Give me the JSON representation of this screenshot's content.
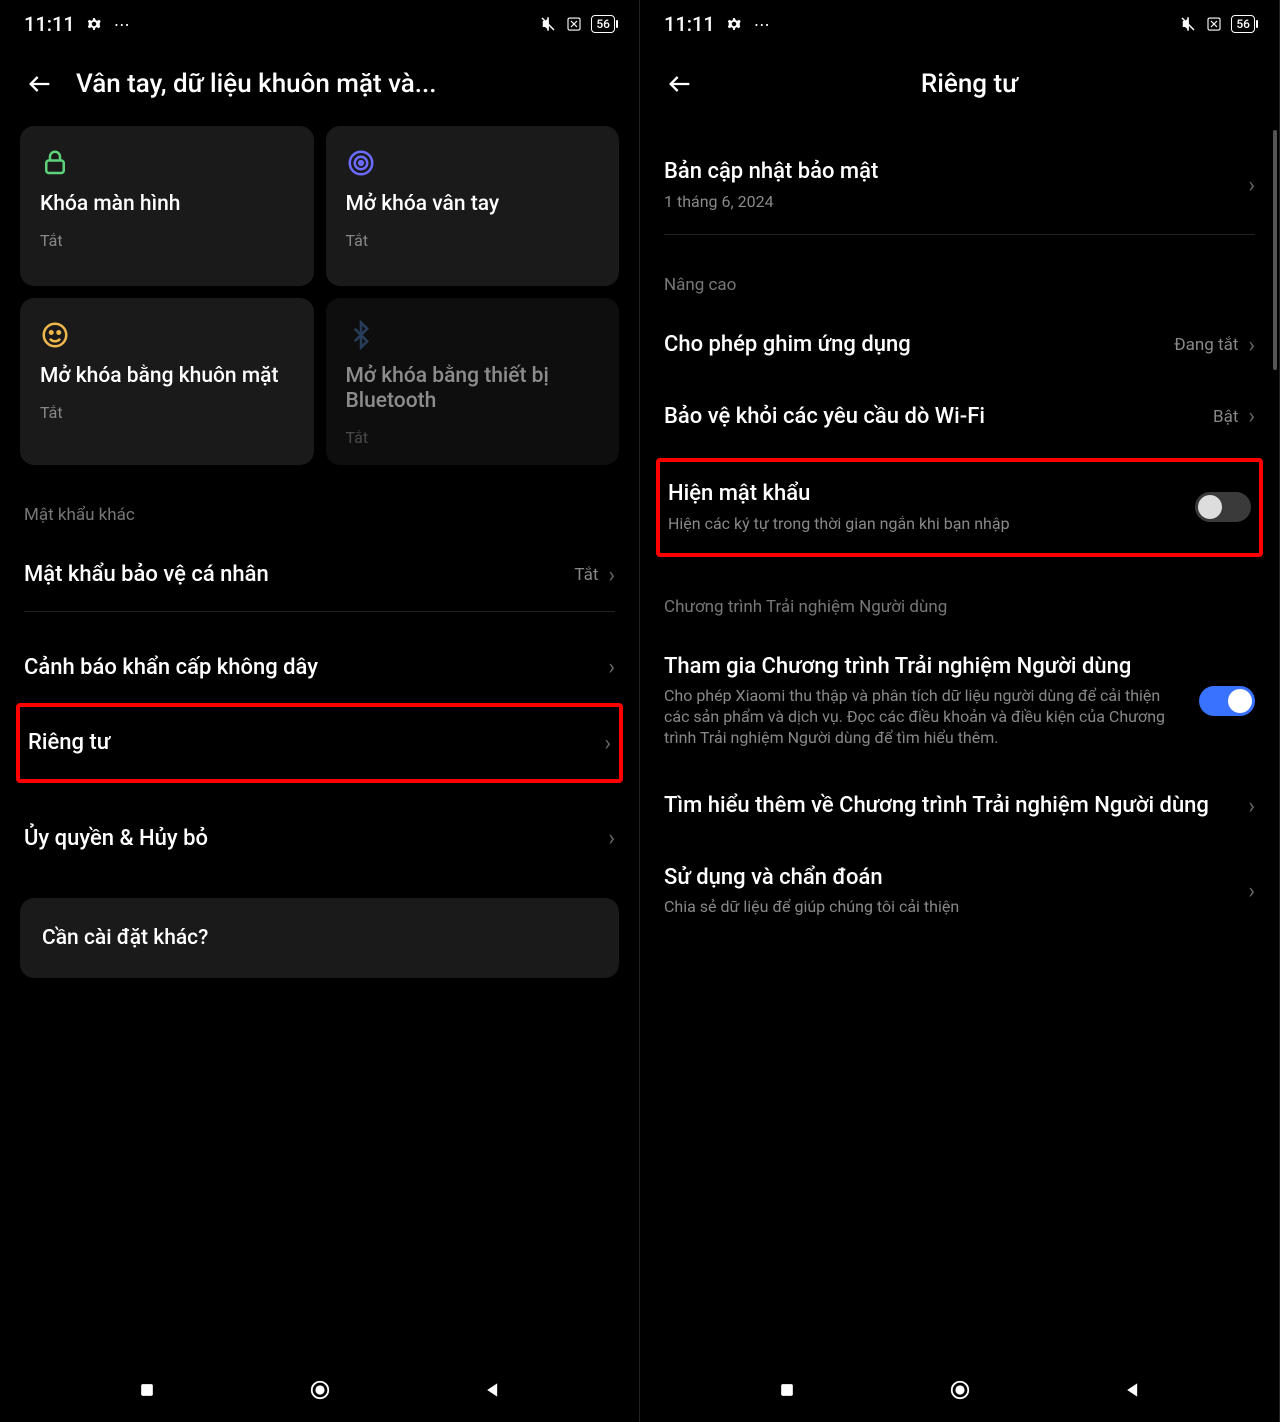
{
  "status": {
    "time": "11:11",
    "battery": "56"
  },
  "left": {
    "title": "Vân tay, dữ liệu khuôn mặt và...",
    "cards": [
      {
        "title": "Khóa màn hình",
        "status": "Tắt"
      },
      {
        "title": "Mở khóa vân tay",
        "status": "Tắt"
      },
      {
        "title": "Mở khóa bằng khuôn mặt",
        "status": "Tắt"
      },
      {
        "title": "Mở khóa bằng thiết bị Bluetooth",
        "status": "Tắt"
      }
    ],
    "section_other_pw": "Mật khẩu khác",
    "rows": {
      "privacy_pw": {
        "title": "Mật khẩu bảo vệ cá nhân",
        "value": "Tắt"
      },
      "emergency": {
        "title": "Cảnh báo khẩn cấp không dây"
      },
      "privacy": {
        "title": "Riêng tư"
      },
      "authorize": {
        "title": "Ủy quyền & Hủy bỏ"
      }
    },
    "footer": "Cần cài đặt khác?"
  },
  "right": {
    "title": "Riêng tư",
    "rows": {
      "security_update": {
        "title": "Bản cập nhật bảo mật",
        "sub": "1 tháng 6, 2024"
      }
    },
    "section_advanced": "Nâng cao",
    "advanced": {
      "pin": {
        "title": "Cho phép ghim ứng dụng",
        "value": "Đang tắt"
      },
      "wifi": {
        "title": "Bảo vệ khỏi các yêu cầu dò Wi-Fi",
        "value": "Bật"
      },
      "show_pw": {
        "title": "Hiện mật khẩu",
        "sub": "Hiện các ký tự trong thời gian ngắn khi bạn nhập"
      }
    },
    "section_uep": "Chương trình Trải nghiệm Người dùng",
    "uep": {
      "join": {
        "title": "Tham gia Chương trình Trải nghiệm Người dùng",
        "sub": "Cho phép Xiaomi thu thập và phân tích dữ liệu người dùng để cải thiện các sản phẩm và dịch vụ. Đọc các điều khoản và điều kiện của Chương trình Trải nghiệm Người dùng để tìm hiểu thêm."
      },
      "learn": {
        "title": "Tìm hiểu thêm về Chương trình Trải nghiệm Người dùng"
      },
      "diag": {
        "title": "Sử dụng và chẩn đoán",
        "sub": "Chia sẻ dữ liệu để giúp chúng tôi cải thiện"
      }
    }
  }
}
